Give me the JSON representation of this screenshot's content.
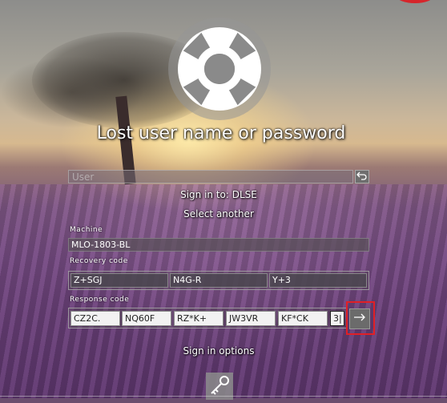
{
  "dialog": {
    "title": "Lost user name or password",
    "icon": "lifebuoy-icon"
  },
  "user": {
    "placeholder": "User",
    "value": "",
    "back_icon": "back-arrow-icon"
  },
  "sign_in_to": "Sign in to: DLSE",
  "select_another": "Select another",
  "machine": {
    "label": "Machine",
    "value": "MLO-1803-BL"
  },
  "recovery": {
    "label": "Recovery code",
    "codes": [
      "Z+SGJ",
      "N4G-R",
      "Y+3"
    ]
  },
  "response": {
    "label": "Response code",
    "codes": [
      "CZ2C.",
      "NQ60F",
      "RZ*K+",
      "JW3VR",
      "KF*CK",
      "3|"
    ],
    "submit_icon": "arrow-right-icon"
  },
  "sign_in_options": "Sign in options",
  "key_icon": "key-icon",
  "colors": {
    "highlight": "#e11f26",
    "text": "#ffffff"
  }
}
